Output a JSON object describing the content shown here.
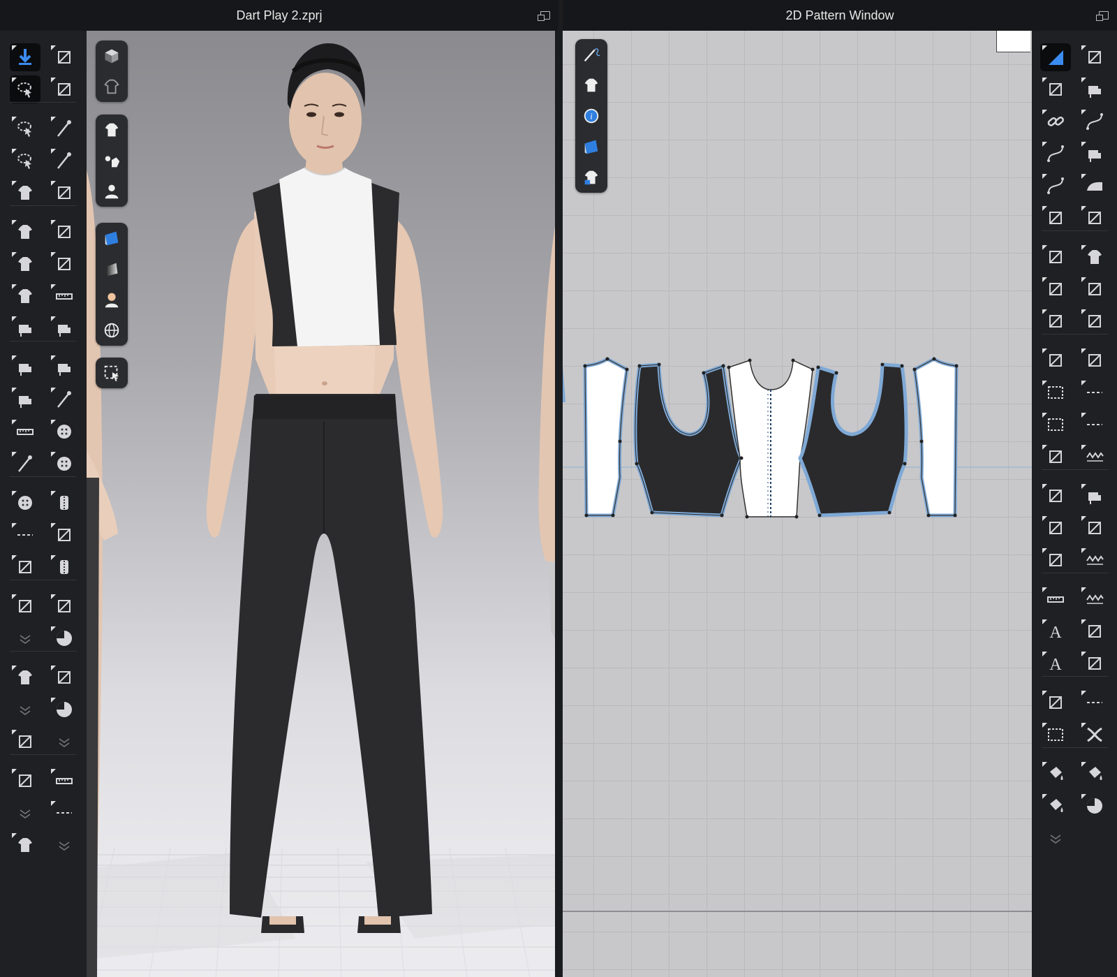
{
  "windows": {
    "viewport_title": "Dart Play 2.zprj",
    "pattern_title": "2D Pattern Window"
  },
  "colors": {
    "toolbar_bg": "#1f2024",
    "titlebar_bg": "#16171a",
    "accent_blue": "#2f7fe0",
    "pattern_grid": "#c8c8ca",
    "outline_blue": "#7fa9d6",
    "fabric_black": "#2a2a2c",
    "fabric_white": "#ffffff"
  },
  "left_toolbar_icons": [
    "simulation-icon",
    "avatar-walk-icon",
    "select-move-icon",
    "fold-arrange-icon",
    "lasso-select-icon",
    "pin-icon",
    "box-select-icon",
    "tack-icon",
    "garment-icon",
    "fold-icon",
    "garment-select-icon",
    "strengthen-icon",
    "garment-move-icon",
    "shrink-icon",
    "garment-fit-icon",
    "measure-icon",
    "sewing-icon",
    "sewing-check-icon",
    "segment-sewing-icon",
    "free-sewing-icon",
    "multi-sewing-icon",
    "seam-taping-icon",
    "avatar-measure-icon",
    "button-select-icon",
    "needle-icon",
    "button-icon",
    "buttonhole-icon",
    "zipper-pull-icon",
    "topstitch-icon",
    "snap-icon",
    "puckering-icon",
    "zipper-icon",
    "drape-icon",
    "belt-icon",
    "expand-icon",
    "pattern-pieces-icon",
    "garment-stack-icon",
    "sheet-icon",
    "expand-icon",
    "piece-flat-icon",
    "flat-icon",
    "expand-icon",
    "trim-icon",
    "tape-icon",
    "expand-icon",
    "stitch-icon",
    "garment-icon",
    "expand-icon"
  ],
  "right_toolbar_icons": [
    "edit-pattern-icon",
    "seam-icon",
    "transform-icon",
    "sewing-icon",
    "link-icon",
    "segment-icon",
    "curve-icon",
    "free-sewing-icon",
    "curve-point-icon",
    "iron-icon",
    "add-point-icon",
    "fold-icon",
    "cut-icon",
    "shirt-icon",
    "internal-line-icon",
    "knit-icon",
    "offset-icon",
    "quilt-icon",
    "slash-icon",
    "pattern-icon",
    "rect-icon",
    "dashed-icon",
    "square-icon",
    "dashed-line-icon",
    "polygon-icon",
    "wave-icon",
    "dart-icon",
    "sewing-edit-icon",
    "dart-dart-icon",
    "elastic-icon",
    "pleat-icon",
    "zigzag-icon",
    "ruler-icon",
    "zigzag2-icon",
    "text-a-icon",
    "add-icon",
    "text-a2-icon",
    "quilt2-icon",
    "annotation-icon",
    "stitch-line-icon",
    "grid-icon",
    "cross-icon",
    "bucket-icon",
    "paint-icon",
    "brush-icon",
    "pie-icon",
    "expand-icon"
  ],
  "viewport_floatbar_icons": [
    "cube-icon",
    "texture-view-icon",
    "shirt-view-icon",
    "garment-settings-icon",
    "avatar-view-icon",
    "fabric-icon",
    "gradient-icon",
    "skin-icon",
    "globe-icon",
    "select-region-icon"
  ],
  "pattern_floatbar_icons": [
    "needle-pen-icon",
    "shirt-icon",
    "info-icon",
    "fabric-icon",
    "lock-shirt-icon"
  ]
}
